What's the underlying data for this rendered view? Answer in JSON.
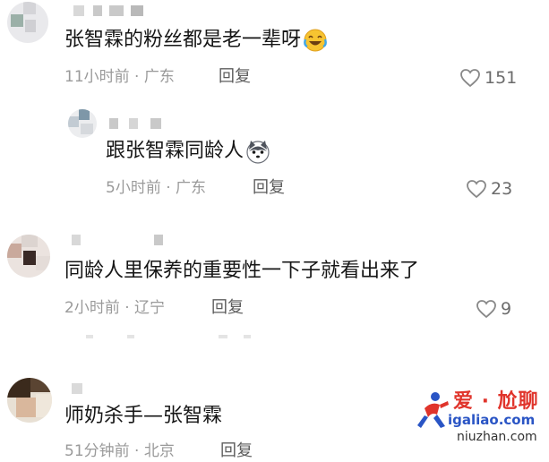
{
  "comments": [
    {
      "text": "张智霖的粉丝都是老一辈呀",
      "emoji": "laughing-emoji",
      "time": "11小时前",
      "location": "广东",
      "reply_label": "回复",
      "likes": "151"
    },
    {
      "text": "跟张智霖同龄人",
      "emoji": "husky-dog-emoji",
      "time": "5小时前",
      "location": "广东",
      "reply_label": "回复",
      "likes": "23"
    },
    {
      "text": "同龄人里保养的重要性一下子就看出来了",
      "time": "2小时前",
      "location": "辽宁",
      "reply_label": "回复",
      "likes": "9"
    },
    {
      "text": "师奶杀手—张智霖",
      "time": "51分钟前",
      "location": "北京",
      "reply_label": "回复"
    }
  ],
  "separator": "·",
  "watermark": {
    "title": "爱 · 尬聊",
    "url": "igaliao.com",
    "url2": "niuzhan.com"
  },
  "icons": {
    "like": "heart-outline-icon"
  },
  "colors": {
    "text": "#161616",
    "meta": "#9a9a9a",
    "reply": "#5c5c5c",
    "watermark_red": "#e0342b",
    "watermark_blue": "#2a55c5"
  }
}
